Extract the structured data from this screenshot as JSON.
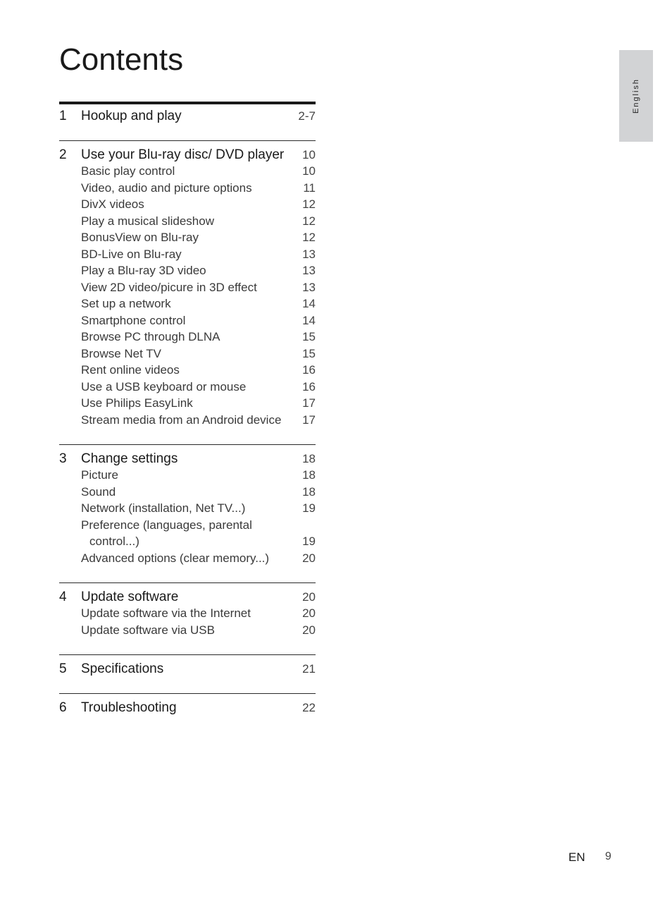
{
  "page_title": "Contents",
  "language_tab": "English",
  "sections": [
    {
      "number": "1",
      "title": "Hookup and play",
      "page": "2-7",
      "items": []
    },
    {
      "number": "2",
      "title": "Use your Blu-ray disc/ DVD player",
      "page": "10",
      "items": [
        {
          "label": "Basic play control",
          "page": "10"
        },
        {
          "label": "Video, audio and picture options",
          "page": "11"
        },
        {
          "label": "DivX videos",
          "page": "12"
        },
        {
          "label": "Play a musical slideshow",
          "page": "12"
        },
        {
          "label": "BonusView on Blu-ray",
          "page": "12"
        },
        {
          "label": "BD-Live on Blu-ray",
          "page": "13"
        },
        {
          "label": "Play a Blu-ray 3D video",
          "page": "13"
        },
        {
          "label": "View 2D video/picure in 3D effect",
          "page": "13"
        },
        {
          "label": "Set up a network",
          "page": "14"
        },
        {
          "label": "Smartphone control",
          "page": "14"
        },
        {
          "label": "Browse PC through DLNA",
          "page": "15"
        },
        {
          "label": "Browse Net TV",
          "page": "15"
        },
        {
          "label": "Rent online videos",
          "page": "16"
        },
        {
          "label": "Use a USB keyboard or mouse",
          "page": "16"
        },
        {
          "label": "Use Philips EasyLink",
          "page": "17"
        },
        {
          "label": "Stream media from an Android device",
          "page": "17"
        }
      ]
    },
    {
      "number": "3",
      "title": "Change settings",
      "page": "18",
      "items": [
        {
          "label": "Picture",
          "page": "18"
        },
        {
          "label": "Sound",
          "page": "18"
        },
        {
          "label": "Network (installation, Net TV...)",
          "page": "19"
        },
        {
          "label": "Preference (languages, parental",
          "page": ""
        },
        {
          "label": "control...)",
          "page": "19",
          "continuation": true
        },
        {
          "label": "Advanced options (clear memory...)",
          "page": "20"
        }
      ]
    },
    {
      "number": "4",
      "title": "Update software",
      "page": "20",
      "items": [
        {
          "label": "Update software via the Internet",
          "page": "20"
        },
        {
          "label": "Update software via USB",
          "page": "20"
        }
      ]
    },
    {
      "number": "5",
      "title": "Specifications",
      "page": "21",
      "items": []
    },
    {
      "number": "6",
      "title": "Troubleshooting",
      "page": "22",
      "items": []
    }
  ],
  "footer": {
    "language": "EN",
    "page_number": "9"
  }
}
